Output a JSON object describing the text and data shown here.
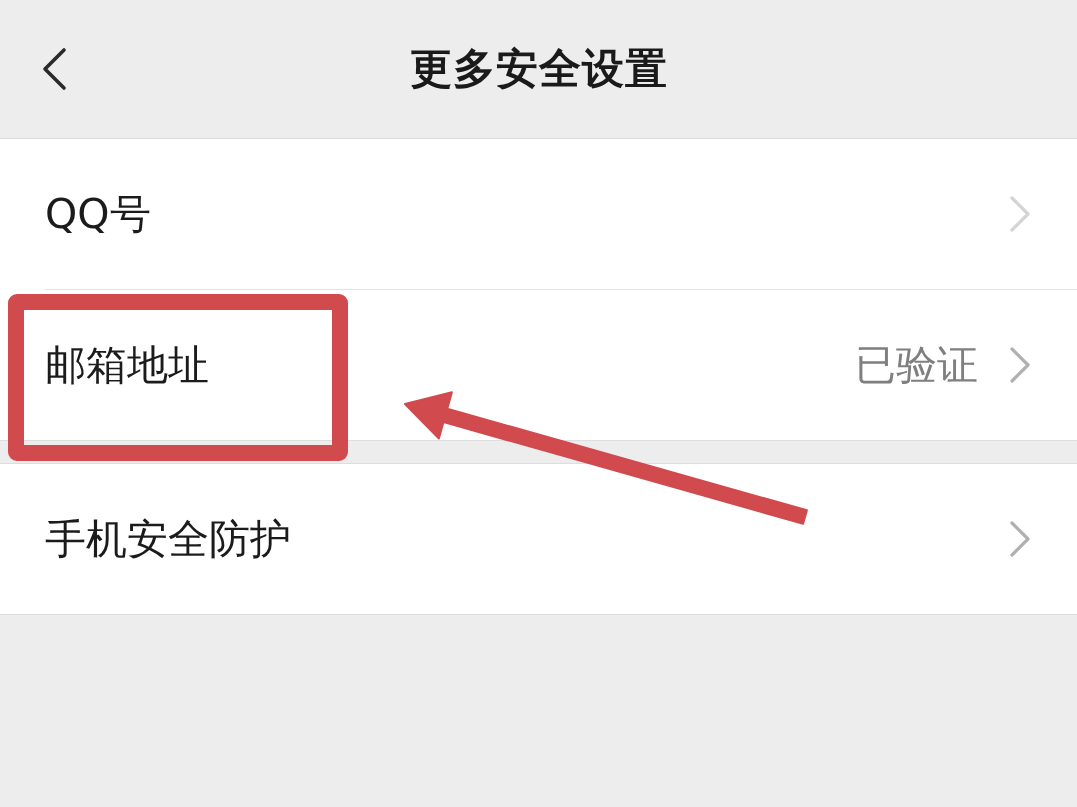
{
  "header": {
    "title": "更多安全设置"
  },
  "sections": [
    {
      "rows": [
        {
          "label": "QQ号",
          "redacted": true,
          "highlighted": false
        },
        {
          "label": "邮箱地址",
          "value": "已验证",
          "redacted": false,
          "highlighted": true
        }
      ]
    },
    {
      "rows": [
        {
          "label": "手机安全防护",
          "redacted": false,
          "highlighted": false
        }
      ]
    }
  ]
}
